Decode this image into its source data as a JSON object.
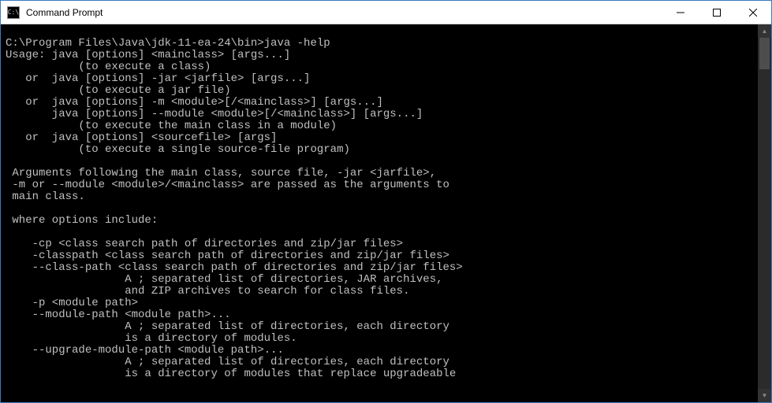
{
  "window": {
    "title": "Command Prompt",
    "icon_glyph": "C:\\"
  },
  "terminal": {
    "lines": [
      "",
      "C:\\Program Files\\Java\\jdk-11-ea-24\\bin>java -help",
      "Usage: java [options] <mainclass> [args...]",
      "           (to execute a class)",
      "   or  java [options] -jar <jarfile> [args...]",
      "           (to execute a jar file)",
      "   or  java [options] -m <module>[/<mainclass>] [args...]",
      "       java [options] --module <module>[/<mainclass>] [args...]",
      "           (to execute the main class in a module)",
      "   or  java [options] <sourcefile> [args]",
      "           (to execute a single source-file program)",
      "",
      " Arguments following the main class, source file, -jar <jarfile>,",
      " -m or --module <module>/<mainclass> are passed as the arguments to",
      " main class.",
      "",
      " where options include:",
      "",
      "    -cp <class search path of directories and zip/jar files>",
      "    -classpath <class search path of directories and zip/jar files>",
      "    --class-path <class search path of directories and zip/jar files>",
      "                  A ; separated list of directories, JAR archives,",
      "                  and ZIP archives to search for class files.",
      "    -p <module path>",
      "    --module-path <module path>...",
      "                  A ; separated list of directories, each directory",
      "                  is a directory of modules.",
      "    --upgrade-module-path <module path>...",
      "                  A ; separated list of directories, each directory",
      "                  is a directory of modules that replace upgradeable"
    ]
  }
}
